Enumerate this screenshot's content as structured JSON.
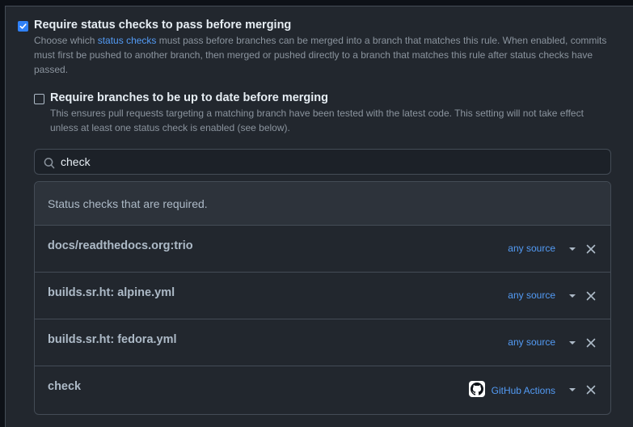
{
  "status_checks_option": {
    "checked": true,
    "title": "Require status checks to pass before merging",
    "desc_pre": "Choose which ",
    "desc_link": "status checks",
    "desc_line1_rest": " must pass before branches can be merged into a branch that matches this rule. When enabled, commits",
    "desc_line2": "must first be pushed to another branch, then merged or pushed directly to a branch that matches this rule after status checks have",
    "desc_line3": "passed."
  },
  "up_to_date_option": {
    "checked": false,
    "title": "Require branches to be up to date before merging",
    "desc_line1": "This ensures pull requests targeting a matching branch have been tested with the latest code. This setting will not take effect",
    "desc_line2": "unless at least one status check is enabled (see below)."
  },
  "search": {
    "value": "check",
    "icon": "search-icon"
  },
  "required_checks": {
    "header": "Status checks that are required.",
    "rows": [
      {
        "name": "docs/readthedocs.org:trio",
        "source": "any source"
      },
      {
        "name": "builds.sr.ht: alpine.yml",
        "source": "any source"
      },
      {
        "name": "builds.sr.ht: fedora.yml",
        "source": "any source"
      },
      {
        "name": "check",
        "source": "GitHub Actions",
        "source_icon": "github-icon"
      }
    ]
  },
  "colors": {
    "accent": "#2f81f7",
    "link": "#539bf5",
    "background": "#22272e",
    "border": "#444c56"
  }
}
